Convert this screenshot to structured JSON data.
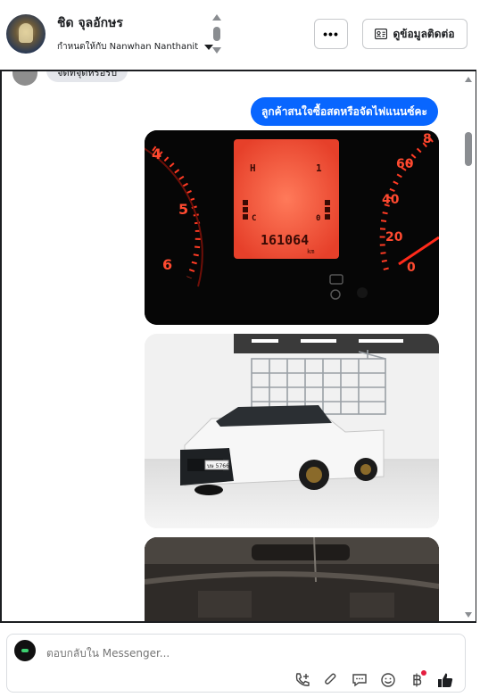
{
  "header": {
    "name": "ชิด จุลอักษร",
    "assign_label": "กำหนดให้กับ Nanwhan Nanthanit",
    "more_label": "•••",
    "contact_label": "ดูข้อมูลติดต่อ"
  },
  "chat": {
    "prev_message": "จัดที่จุดหรือรับ",
    "outgoing_message": "ลูกค้าสนใจซื้อสดหรือจัดไฟแนนซ์คะ",
    "dash_photo": {
      "indicator_left": "H",
      "indicator_right": "1",
      "indicator_c": "C",
      "indicator_zero": "0",
      "odometer": "161064",
      "unit": "km",
      "tick_labels_left": [
        "4",
        "5",
        "6"
      ],
      "tick_labels_right": [
        "8",
        "60",
        "40",
        "20",
        "0"
      ]
    },
    "truck_photo": {
      "plate": "บษ 5766"
    }
  },
  "composer": {
    "placeholder": "ตอบกลับใน Messenger..."
  },
  "colors": {
    "accent": "#0866ff",
    "badge": "#e41e3f"
  }
}
